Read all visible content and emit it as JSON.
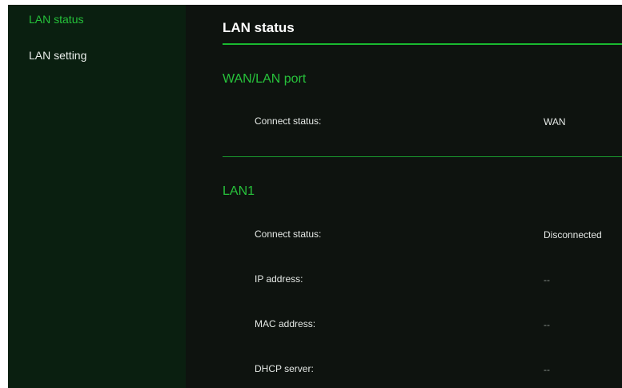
{
  "sidebar": {
    "items": [
      {
        "label": "LAN status",
        "active": true
      },
      {
        "label": "LAN setting",
        "active": false
      }
    ]
  },
  "main": {
    "title": "LAN status",
    "sections": [
      {
        "title": "WAN/LAN port",
        "rows": [
          {
            "label": "Connect status:",
            "value": "WAN"
          }
        ]
      },
      {
        "title": "LAN1",
        "rows": [
          {
            "label": "Connect status:",
            "value": "Disconnected"
          },
          {
            "label": "IP address:",
            "value": "--"
          },
          {
            "label": "MAC address:",
            "value": "--"
          },
          {
            "label": "DHCP server:",
            "value": "--"
          }
        ]
      }
    ]
  },
  "colors": {
    "accent": "#25c13a",
    "sidebar_bg": "#0a1f10",
    "main_bg": "#0e130f",
    "text": "#e4e8e5"
  }
}
